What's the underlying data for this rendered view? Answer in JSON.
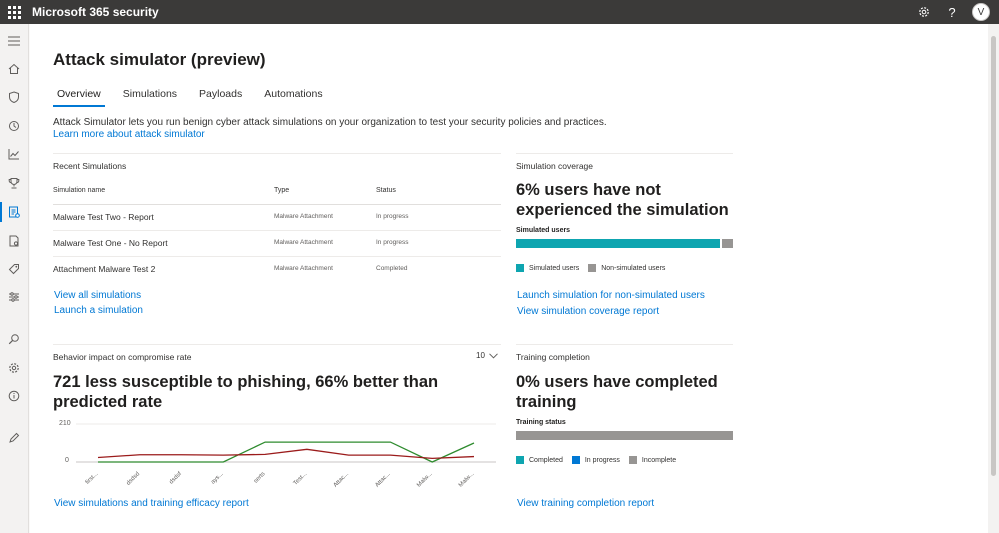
{
  "app": {
    "title": "Microsoft 365 security",
    "user_initial": "V"
  },
  "header_icons": [
    "waffle-icon",
    "gear-icon",
    "help-icon"
  ],
  "nav_icons": [
    "hamburger-icon",
    "home-icon",
    "shield-icon",
    "incidents-icon",
    "chart-icon",
    "trophy-icon",
    "attack-simulator-icon",
    "report-icon",
    "tag-icon",
    "policies-icon",
    "search-icon",
    "settings-icon",
    "info-icon",
    "pencil-icon"
  ],
  "page": {
    "title": "Attack simulator (preview)",
    "tabs": [
      {
        "label": "Overview",
        "active": true
      },
      {
        "label": "Simulations",
        "active": false
      },
      {
        "label": "Payloads",
        "active": false
      },
      {
        "label": "Automations",
        "active": false
      }
    ],
    "intro": "Attack Simulator lets you run benign cyber attack simulations on your organization to test your security policies and practices.",
    "learn_more": "Learn more about attack simulator"
  },
  "recent": {
    "title": "Recent Simulations",
    "columns": [
      "Simulation name",
      "Type",
      "Status"
    ],
    "rows": [
      {
        "name": "Malware Test Two - Report",
        "type": "Malware Attachment",
        "status": "In progress"
      },
      {
        "name": "Malware Test One - No Report",
        "type": "Malware Attachment",
        "status": "In progress"
      },
      {
        "name": "Attachment Malware Test 2",
        "type": "Malware Attachment",
        "status": "Completed"
      }
    ],
    "link_view_all": "View all simulations",
    "link_launch": "Launch a simulation"
  },
  "coverage": {
    "title": "Simulation coverage",
    "headline": "6% users have not experienced the simulation",
    "bar_label": "Simulated users",
    "simulated_fraction": 0.94,
    "legend": [
      "Simulated users",
      "Non-simulated users"
    ],
    "link_launch": "Launch simulation for non-simulated users",
    "link_report": "View simulation coverage report"
  },
  "behavior": {
    "title": "Behavior impact on compromise rate",
    "dropdown_value": "10",
    "headline": "721 less susceptible to phishing, 66% better than predicted rate",
    "link_report": "View simulations and training efficacy report"
  },
  "training": {
    "title": "Training completion",
    "headline": "0% users have completed training",
    "bar_label": "Training status",
    "completed_fraction": 0,
    "legend": [
      "Completed",
      "In progress",
      "Incomplete"
    ],
    "link_report": "View training completion report"
  },
  "colors": {
    "accent": "#0078d4",
    "simulated": "#0ea5b0",
    "non_simulated": "#979593",
    "completed": "#0ea5b0",
    "in_progress": "#0078d4",
    "incomplete": "#979593",
    "series_green": "#2e8b2e",
    "series_red": "#9b1b1b"
  },
  "chart_data": {
    "type": "line",
    "categories": [
      "first...",
      "dsdsd",
      "dsdsf",
      "ays...",
      "serts",
      "Test...",
      "Attac...",
      "Attac...",
      "Malw...",
      "Malw..."
    ],
    "ylim": [
      0,
      210
    ],
    "yticks": [
      0,
      210
    ],
    "series": [
      {
        "values": [
          0,
          0,
          0,
          0,
          110,
          110,
          110,
          110,
          0,
          105
        ]
      },
      {
        "values": [
          25,
          40,
          40,
          38,
          42,
          70,
          38,
          38,
          20,
          30
        ]
      }
    ]
  }
}
